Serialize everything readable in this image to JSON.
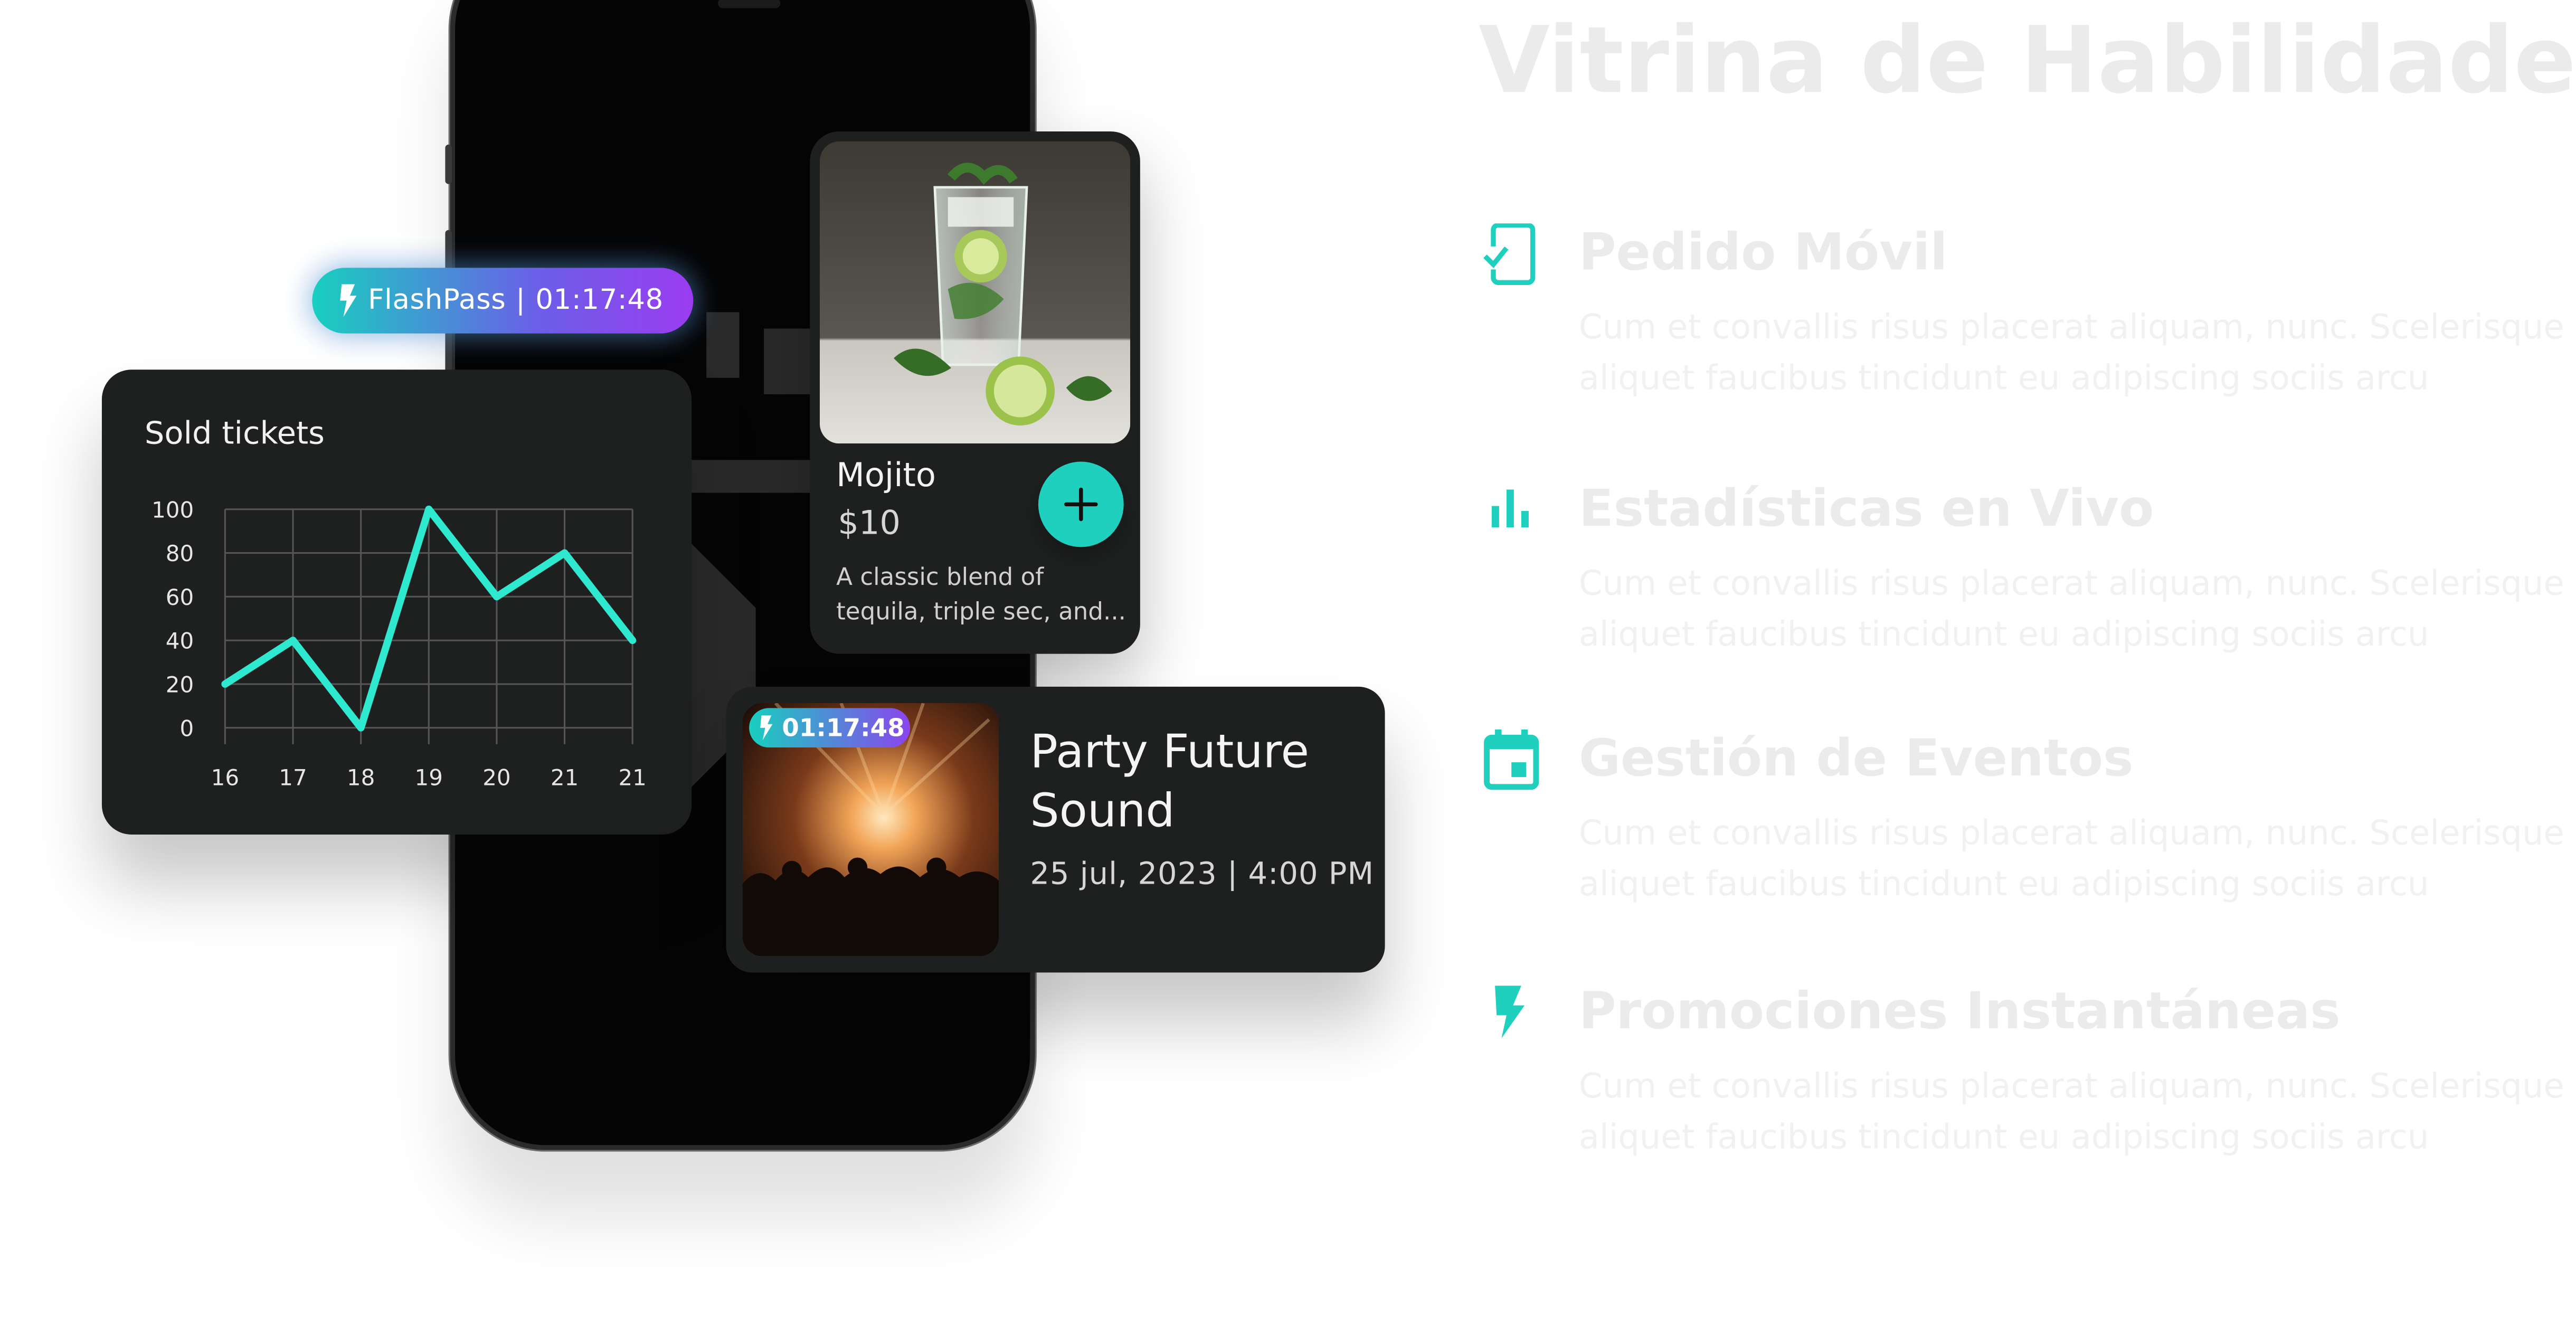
{
  "flashpass": {
    "label": "FlashPass",
    "separator": "|",
    "timer": "01:17:48"
  },
  "chart_data": {
    "type": "line",
    "title": "Sold tickets",
    "xlabel": "",
    "ylabel": "",
    "categories": [
      "16",
      "17",
      "18",
      "19",
      "20",
      "21",
      "21"
    ],
    "values": [
      20,
      40,
      0,
      100,
      60,
      80,
      40
    ],
    "yticks": [
      "0",
      "20",
      "40",
      "60",
      "80",
      "100"
    ],
    "ylim": [
      0,
      100
    ],
    "grid": true,
    "line_color": "#2ee8cf"
  },
  "mojito": {
    "name": "Mojito",
    "price": "$10",
    "description": "A classic blend of tequila, triple sec, and...",
    "add_icon": "plus-icon"
  },
  "event": {
    "timer": "01:17:48",
    "title": "Party Future Sound",
    "date": "25 jul, 2023 | 4:00 PM"
  },
  "showcase": {
    "title": "Vitrina de Habilidades",
    "accent": "#1ed0bd",
    "features": [
      {
        "icon": "mobile-check-icon",
        "title": "Pedido Móvil",
        "body1": "Cum et convallis risus placerat aliquam, nunc. Scelerisque",
        "body2": "aliquet faucibus tincidunt eu adipiscing sociis arcu"
      },
      {
        "icon": "bar-chart-icon",
        "title": "Estadísticas en Vivo",
        "body1": "Cum et convallis risus placerat aliquam, nunc. Scelerisque",
        "body2": "aliquet faucibus tincidunt eu adipiscing sociis arcu"
      },
      {
        "icon": "calendar-icon",
        "title": "Gestión de Eventos",
        "body1": "Cum et convallis risus placerat aliquam, nunc. Scelerisque",
        "body2": "aliquet faucibus tincidunt eu adipiscing sociis arcu"
      },
      {
        "icon": "lightning-icon",
        "title": "Promociones Instantáneas",
        "body1": "Cum et convallis risus placerat aliquam, nunc. Scelerisque",
        "body2": "aliquet faucibus tincidunt eu adipiscing sociis arcu"
      }
    ]
  }
}
